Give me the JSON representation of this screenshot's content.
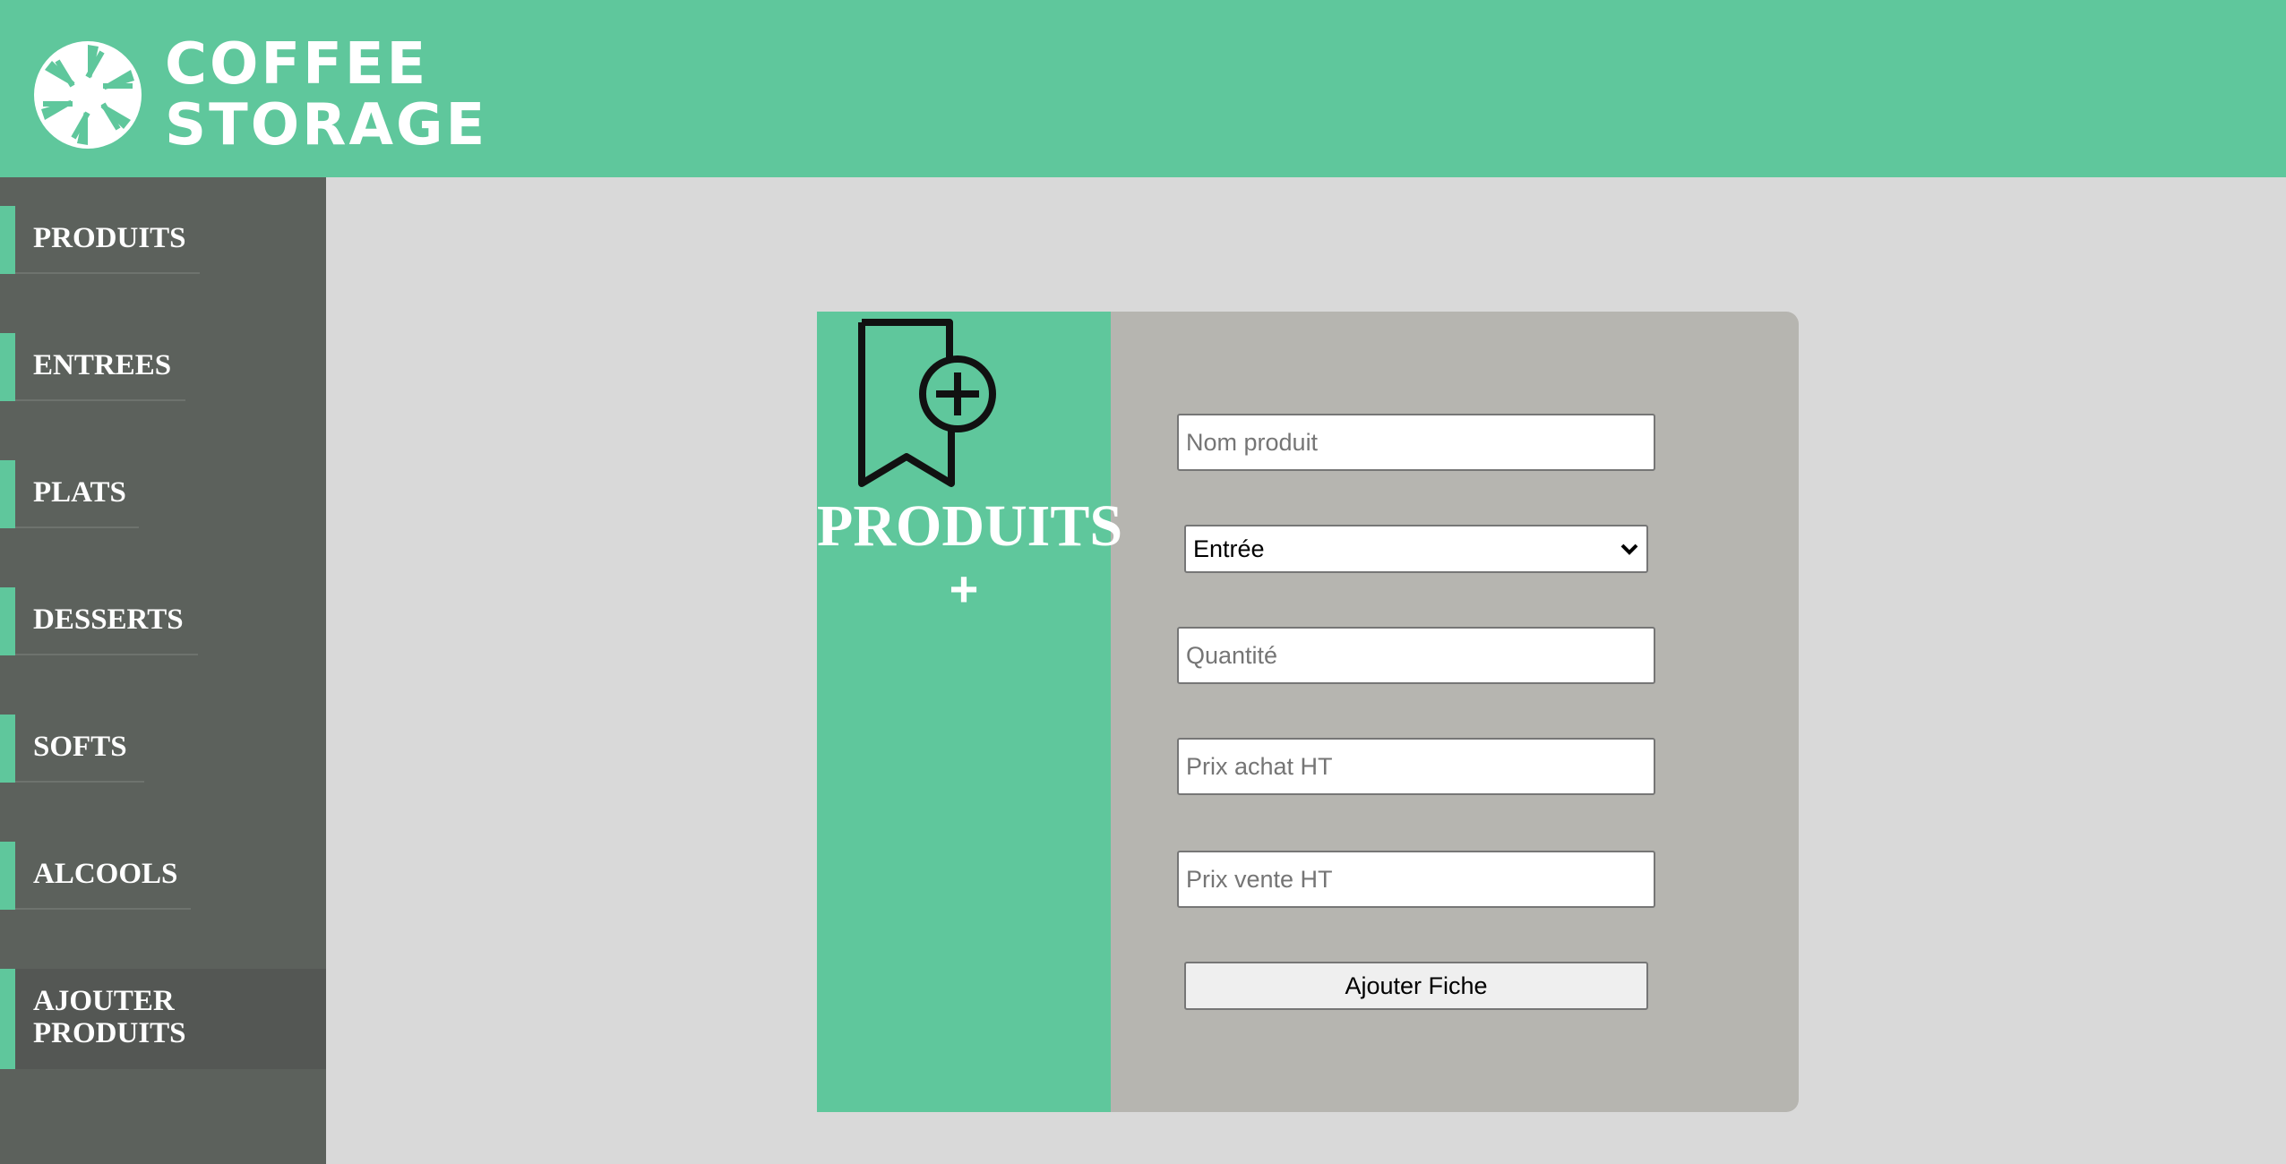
{
  "header": {
    "brand_line1": "COFFEE",
    "brand_line2": "STORAGE",
    "background_color": "#5fc79c"
  },
  "sidebar": {
    "items": [
      {
        "label": "PRODUITS"
      },
      {
        "label": "ENTREES"
      },
      {
        "label": "PLATS"
      },
      {
        "label": "DESSERTS"
      },
      {
        "label": "SOFTS"
      },
      {
        "label": "ALCOOLS"
      },
      {
        "label_line1": "AJOUTER",
        "label_line2": "PRODUITS",
        "active": true
      }
    ],
    "accent_color": "#5fc79c",
    "background_color": "#5c615c"
  },
  "card": {
    "icon": "bookmark-add-icon",
    "title": "PRODUITS",
    "plus": "+"
  },
  "form": {
    "name_placeholder": "Nom produit",
    "category_selected": "Entrée",
    "quantity_placeholder": "Quantité",
    "buy_price_placeholder": "Prix achat HT",
    "sell_price_placeholder": "Prix vente HT",
    "submit_label": "Ajouter Fiche"
  }
}
